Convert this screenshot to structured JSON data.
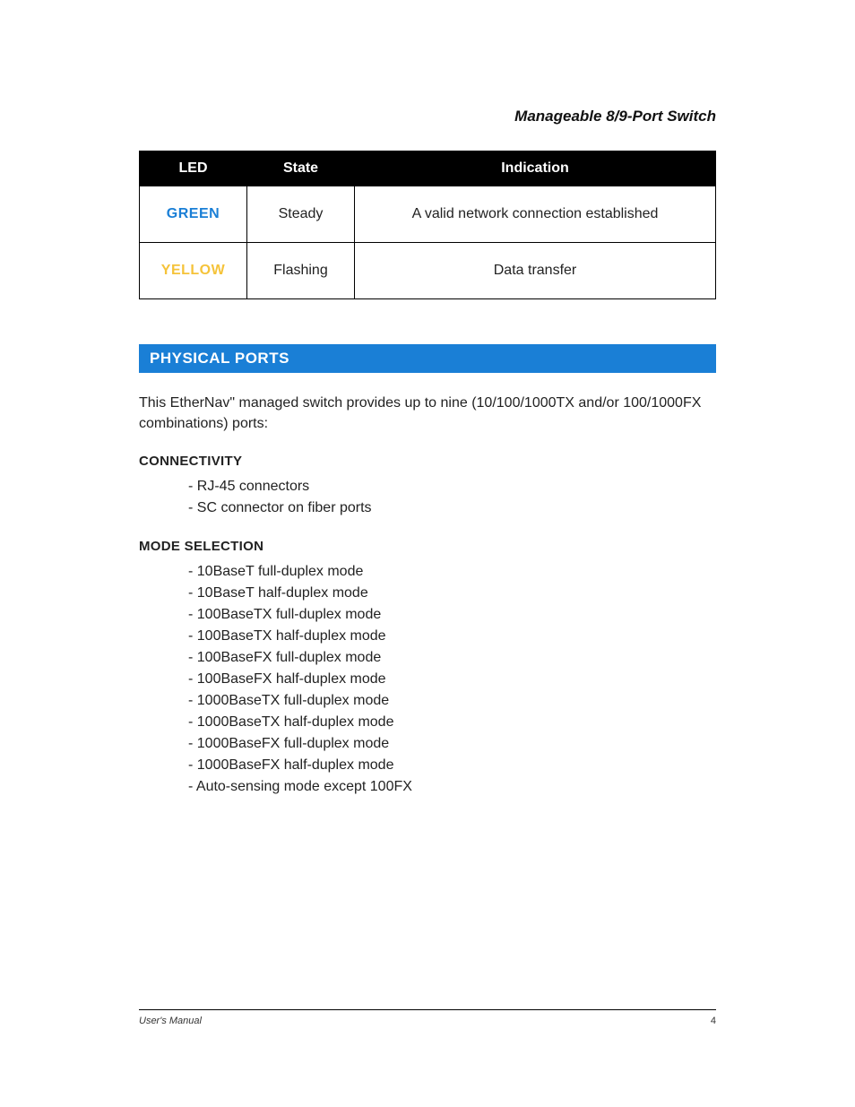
{
  "header": {
    "title": "Manageable 8/9-Port Switch"
  },
  "table": {
    "headers": [
      "LED",
      "State",
      "Indication"
    ],
    "rows": [
      {
        "led": "GREEN",
        "ledClass": "led-green",
        "state": "Steady",
        "indication": "A valid network connection established"
      },
      {
        "led": "YELLOW",
        "ledClass": "led-yellow",
        "state": "Flashing",
        "indication": "Data transfer"
      }
    ]
  },
  "section": {
    "title": "PHYSICAL PORTS",
    "intro": "This EtherNav\" managed switch provides up to nine (10/100/1000TX and/or 100/1000FX combinations) ports:",
    "connectivity": {
      "heading": "CONNECTIVITY",
      "items": [
        "RJ-45 connectors",
        "SC connector on fiber ports"
      ]
    },
    "mode": {
      "heading": "MODE SELECTION",
      "items": [
        "10BaseT full-duplex mode",
        "10BaseT half-duplex mode",
        "100BaseTX full-duplex mode",
        "100BaseTX half-duplex mode",
        "100BaseFX full-duplex mode",
        "100BaseFX half-duplex mode",
        "1000BaseTX full-duplex mode",
        "1000BaseTX half-duplex mode",
        "1000BaseFX full-duplex mode",
        "1000BaseFX half-duplex mode",
        "Auto-sensing mode except 100FX"
      ]
    }
  },
  "footer": {
    "left": "User's Manual",
    "page": "4"
  }
}
